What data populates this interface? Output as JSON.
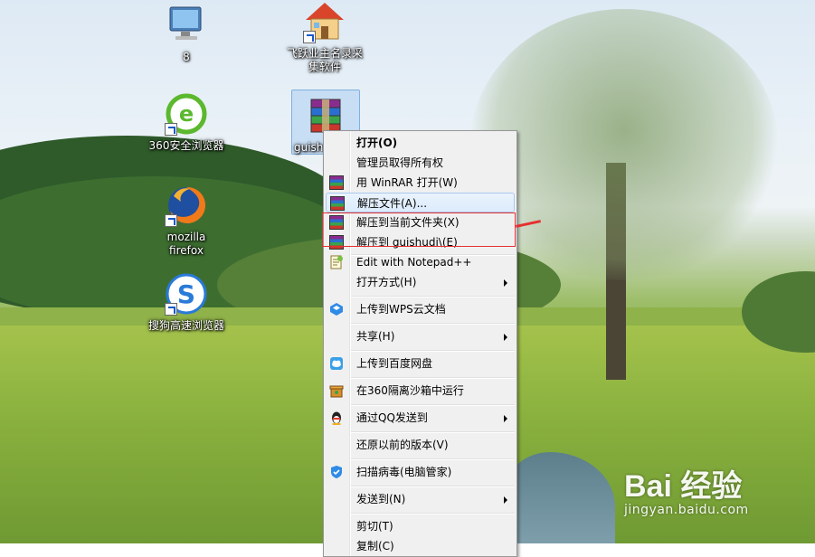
{
  "desktop": {
    "icons": [
      {
        "label": "8",
        "icon": "computer-icon"
      },
      {
        "label": "飞跃业主名录采集软件",
        "icon": "house-icon"
      },
      {
        "label": "360安全浏览器",
        "icon": "360-browser-icon"
      },
      {
        "label": "guishu",
        "icon": "winrar-archive-icon"
      },
      {
        "label": "mozilla firefox",
        "icon": "firefox-icon"
      },
      {
        "label": "搜狗高速浏览器",
        "icon": "sogou-browser-icon"
      }
    ]
  },
  "context_menu": {
    "items": [
      {
        "label": "打开(O)",
        "bold": true
      },
      {
        "label": "管理员取得所有权"
      },
      {
        "label": "用 WinRAR 打开(W)",
        "icon": "winrar-icon"
      },
      {
        "label": "解压文件(A)...",
        "icon": "winrar-icon",
        "highlighted": true
      },
      {
        "label": "解压到当前文件夹(X)",
        "icon": "winrar-icon"
      },
      {
        "label": "解压到 guishudi\\(E)",
        "icon": "winrar-icon"
      },
      {
        "label": "Edit with Notepad++",
        "icon": "notepad-plus-icon"
      },
      {
        "label": "打开方式(H)",
        "submenu": true
      },
      {
        "label": "上传到WPS云文档",
        "icon": "wps-cloud-icon"
      },
      {
        "label": "共享(H)",
        "submenu": true
      },
      {
        "label": "上传到百度网盘",
        "icon": "baidu-netdisk-icon"
      },
      {
        "label": "在360隔离沙箱中运行",
        "icon": "sandbox-360-icon"
      },
      {
        "label": "通过QQ发送到",
        "icon": "qq-icon",
        "submenu": true
      },
      {
        "label": "还原以前的版本(V)"
      },
      {
        "label": "扫描病毒(电脑管家)",
        "icon": "tencent-pc-manager-icon"
      },
      {
        "label": "发送到(N)",
        "submenu": true
      },
      {
        "label": "剪切(T)"
      },
      {
        "label": "复制(C)"
      }
    ]
  },
  "watermark": {
    "brand": "Bai 经验",
    "url": "jingyan.baidu.com"
  },
  "colors": {
    "highlight_box": "#e53030",
    "menu_bg": "#f0f0f0",
    "hover_border": "#a8c9ee"
  }
}
